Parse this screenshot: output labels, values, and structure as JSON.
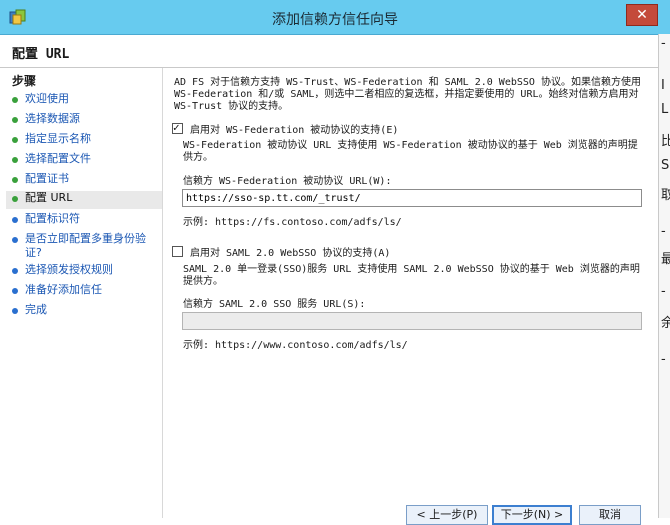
{
  "window": {
    "title": "添加信赖方信任向导",
    "close_glyph": "✕"
  },
  "page": {
    "title": "配置 URL"
  },
  "sidebar": {
    "heading": "步骤",
    "steps": [
      {
        "label": "欢迎使用",
        "state": "done"
      },
      {
        "label": "选择数据源",
        "state": "done"
      },
      {
        "label": "指定显示名称",
        "state": "done"
      },
      {
        "label": "选择配置文件",
        "state": "done"
      },
      {
        "label": "配置证书",
        "state": "done"
      },
      {
        "label": "配置 URL",
        "state": "current"
      },
      {
        "label": "配置标识符",
        "state": "pending"
      },
      {
        "label": "是否立即配置多重身份验证?",
        "state": "pending"
      },
      {
        "label": "选择颁发授权规则",
        "state": "pending"
      },
      {
        "label": "准备好添加信任",
        "state": "pending"
      },
      {
        "label": "完成",
        "state": "pending"
      }
    ]
  },
  "content": {
    "intro": "AD FS 对于信赖方支持 WS-Trust、WS-Federation 和 SAML 2.0 WebSSO 协议。如果信赖方使用 WS-Federation 和/或 SAML，则选中二者相应的复选框，并指定要使用的 URL。始终对信赖方启用对 WS-Trust 协议的支持。",
    "wsfed": {
      "checkbox_label": "启用对 WS-Federation 被动协议的支持(E)",
      "checked": true,
      "description": "WS-Federation 被动协议 URL 支持使用 WS-Federation 被动协议的基于 Web 浏览器的声明提供方。",
      "field_label": "信赖方 WS-Federation 被动协议 URL(W):",
      "value": "https://sso-sp.tt.com/_trust/",
      "example": "示例: https://fs.contoso.com/adfs/ls/"
    },
    "saml": {
      "checkbox_label": "启用对 SAML 2.0 WebSSO 协议的支持(A)",
      "checked": false,
      "description": "SAML 2.0 单一登录(SSO)服务 URL 支持使用 SAML 2.0 WebSSO 协议的基于 Web 浏览器的声明提供方。",
      "field_label": "信赖方 SAML 2.0 SSO 服务 URL(S):",
      "value": "",
      "example": "示例: https://www.contoso.com/adfs/ls/"
    }
  },
  "buttons": {
    "prev": "< 上一步(P)",
    "next": "下一步(N) >",
    "cancel": "取消"
  },
  "right_strip_chars": [
    "-",
    "I",
    "L",
    "比",
    "S",
    "取",
    "-",
    "最",
    "-",
    "余",
    "-"
  ],
  "colors": {
    "titlebar": "#67cbef",
    "step_done": "#39a03b",
    "step_pending": "#2a6fcf",
    "link": "#1b57b3"
  }
}
